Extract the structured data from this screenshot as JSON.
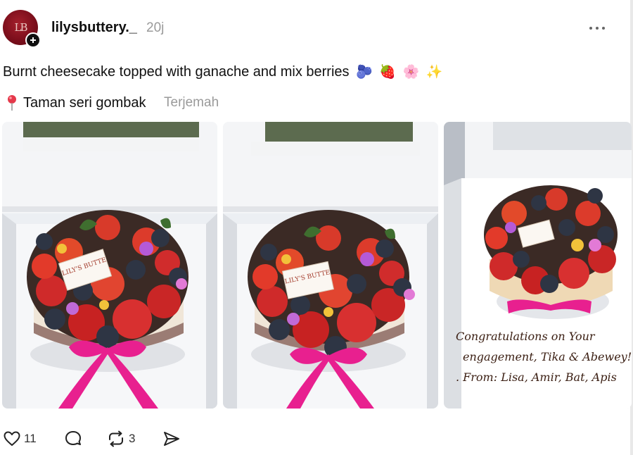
{
  "post": {
    "username": "lilysbuttery._",
    "time": "20j",
    "caption": "Burnt cheesecake topped with ganache and mix berries",
    "caption_emojis": [
      "🫐",
      "🍓",
      "🌸",
      "✨"
    ],
    "location": "Taman seri gombak",
    "translate_label": "Terjemah"
  },
  "photos": [
    {
      "alt": "Burnt cheesecake in box with berries and pink ribbon",
      "tag": "LILY'S BUTTE"
    },
    {
      "alt": "Burnt cheesecake in box with berries and pink ribbon",
      "tag": "LILY'S BUTTE"
    },
    {
      "alt": "Burnt cheesecake in box with handwritten message"
    }
  ],
  "handwritten_note": {
    "line1": "Congratulations on Your",
    "line2": "engagement, Tika & Abewey!",
    "line3": ". From: Lisa, Amir, Bat, Apis"
  },
  "actions": {
    "likes": "11",
    "reposts": "3"
  },
  "icons": {
    "like": "heart-icon",
    "comment": "comment-bubble-icon",
    "repost": "repost-icon",
    "share": "send-icon",
    "more": "more-horizontal-icon",
    "pin": "location-pin-icon"
  },
  "colors": {
    "text": "#101010",
    "muted": "#9a9a9a",
    "ribbon": "#e8208f",
    "strawberry": "#d42b2b",
    "blueberry": "#2e3544"
  }
}
